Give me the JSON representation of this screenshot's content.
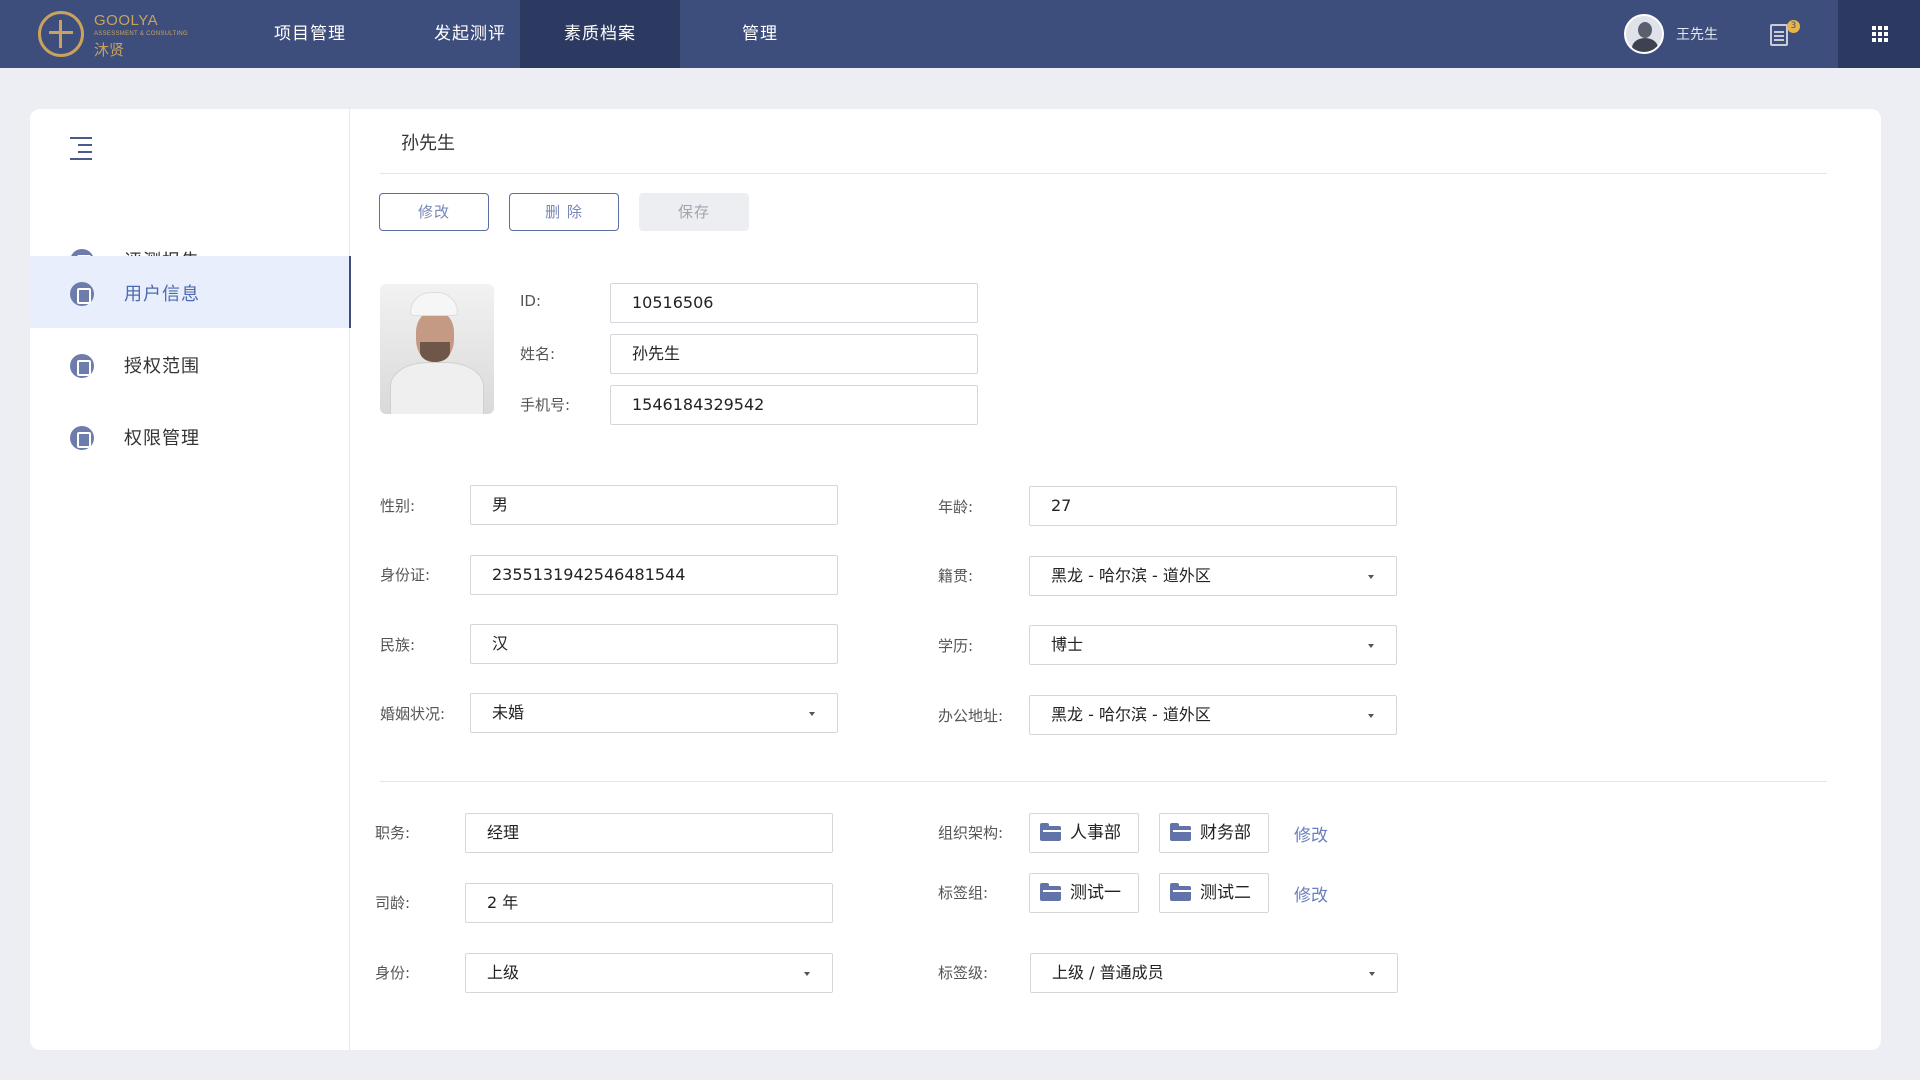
{
  "logo": {
    "en": "GOOLYA",
    "sub": "ASSESSMENT & CONSULTING",
    "cn": "沐贤"
  },
  "nav": [
    {
      "label": "项目管理"
    },
    {
      "label": "发起测评"
    },
    {
      "label": "素质档案",
      "active": true
    },
    {
      "label": "管理"
    }
  ],
  "user": {
    "name": "王先生",
    "notification_count": "3"
  },
  "sidebar": {
    "items": [
      {
        "label": "评测报告",
        "icon": "report-icon"
      },
      {
        "label": "用户信息",
        "icon": "user-icon",
        "active": true
      },
      {
        "label": "授权范围",
        "icon": "scope-icon"
      },
      {
        "label": "权限管理",
        "icon": "permission-icon"
      }
    ]
  },
  "profile": {
    "title": "孙先生",
    "buttons": {
      "edit": "修改",
      "delete": "删 除",
      "save": "保存"
    },
    "id_label": "ID:",
    "id": "10516506",
    "name_label": "姓名:",
    "name": "孙先生",
    "phone_label": "手机号:",
    "phone": "1546184329542"
  },
  "details": {
    "gender_label": "性别:",
    "gender": "男",
    "age_label": "年龄:",
    "age": "27",
    "idcard_label": "身份证:",
    "idcard": "2355131942546481544",
    "native_label": "籍贯:",
    "native": "黑龙 - 哈尔滨 - 道外区",
    "ethnic_label": "民族:",
    "ethnic": "汉",
    "education_label": "学历:",
    "education": "博士",
    "marital_label": "婚姻状况:",
    "marital": "未婚",
    "office_label": "办公地址:",
    "office": "黑龙 - 哈尔滨 - 道外区"
  },
  "job": {
    "position_label": "职务:",
    "position": "经理",
    "tenure_label": "司龄:",
    "tenure": "2 年",
    "identity_label": "身份:",
    "identity": "上级",
    "org_label": "组织架构:",
    "org_tags": [
      "人事部",
      "财务部"
    ],
    "org_edit": "修改",
    "taggroup_label": "标签组:",
    "tag_groups": [
      "测试一",
      "测试二"
    ],
    "taggroup_edit": "修改",
    "taglevel_label": "标签级:",
    "taglevel": "上级 / 普通成员"
  },
  "colors": {
    "topbar": "#3d4d7c",
    "nav_active": "#2c3960",
    "accent": "#6b7fc0",
    "logo_gold": "#c9a35e"
  }
}
